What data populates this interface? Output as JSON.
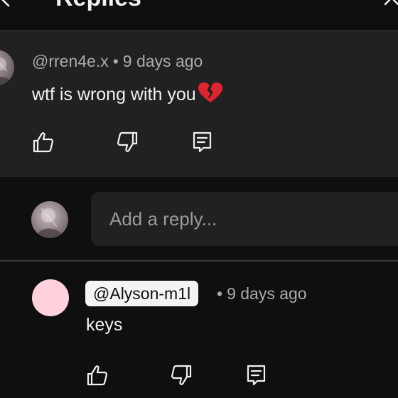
{
  "header": {
    "title": "Replies"
  },
  "parent_comment": {
    "author": "@rren4e.x",
    "separator": "•",
    "time": "9 days ago",
    "text": "wtf is wrong with you",
    "emoji": "broken-heart-icon"
  },
  "composer": {
    "placeholder": "Add a reply..."
  },
  "reply": {
    "author": "@Alyson-m1l",
    "separator": "•",
    "time": "9 days ago",
    "text": "keys",
    "avatar_color": "#ffd1dc"
  },
  "icons": {
    "like": "thumbs-up-icon",
    "dislike": "thumbs-down-icon",
    "reply": "reply-comment-icon"
  },
  "colors": {
    "background": "#0f0f0f",
    "card": "#212121",
    "text_primary": "#f1f1f1",
    "text_secondary": "#aaaaaa",
    "broken_heart": "#e0242f"
  }
}
